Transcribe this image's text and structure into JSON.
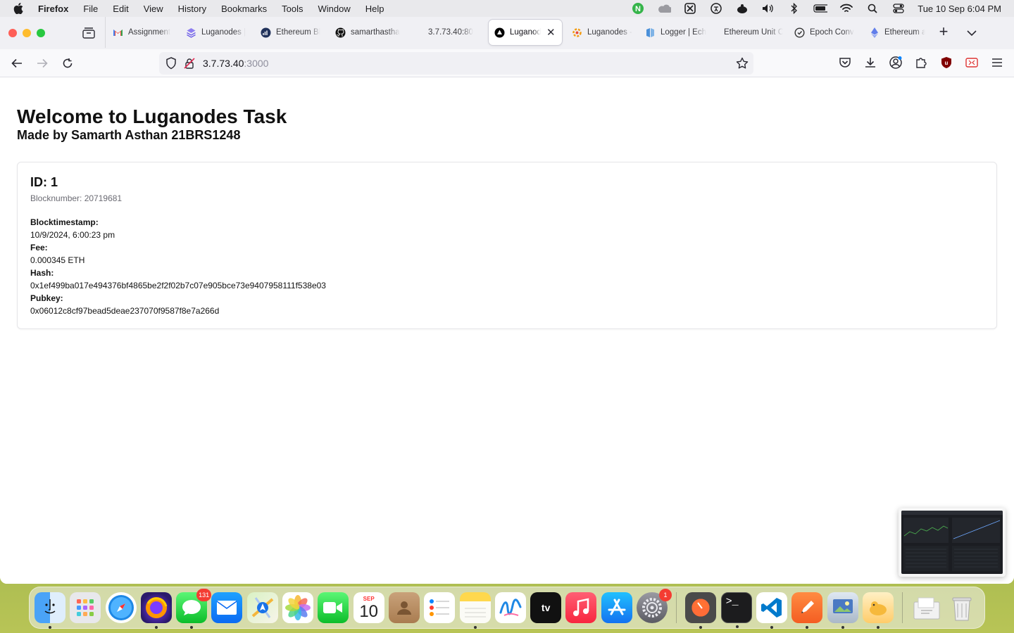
{
  "menubar": {
    "app_name": "Firefox",
    "items": [
      "File",
      "Edit",
      "View",
      "History",
      "Bookmarks",
      "Tools",
      "Window",
      "Help"
    ],
    "clock": "Tue 10 Sep  6:04 PM"
  },
  "tabs": [
    {
      "title": "Assignment",
      "icon": "gmail-icon",
      "color": "#ea4335"
    },
    {
      "title": "Luganodes |",
      "icon": "luganodes-icon",
      "color": "#6c5ce7"
    },
    {
      "title": "Ethereum Bl",
      "icon": "etherscan-icon",
      "color": "#21325b"
    },
    {
      "title": "samarthastha",
      "icon": "github-icon",
      "color": "#111111"
    },
    {
      "title": "3.7.73.40:80",
      "icon": "",
      "color": ""
    },
    {
      "title": "Luganodes",
      "icon": "triangle-icon",
      "color": "#000000",
      "active": true
    },
    {
      "title": "Luganodes -",
      "icon": "luganodes-icon",
      "color": "#f39c12"
    },
    {
      "title": "Logger | Ech",
      "icon": "logger-icon",
      "color": "#4a90d9"
    },
    {
      "title": "Ethereum Unit C",
      "icon": "",
      "color": ""
    },
    {
      "title": "Epoch Conv",
      "icon": "clock-icon",
      "color": "#333333"
    },
    {
      "title": "Ethereum ac",
      "icon": "ethereum-icon",
      "color": "#627eea"
    }
  ],
  "navbar": {
    "url_host": "3.7.73.40",
    "url_port": ":3000"
  },
  "page": {
    "title": "Welcome to Luganodes Task",
    "subtitle": "Made by Samarth Asthan 21BRS1248"
  },
  "record": {
    "id_text": "ID: 1",
    "blocknumber_text": "Blocknumber: 20719681",
    "blocktimestamp_label": "Blocktimestamp:",
    "blocktimestamp_value": "10/9/2024, 6:00:23 pm",
    "fee_label": "Fee:",
    "fee_value": "0.000345 ETH",
    "hash_label": "Hash:",
    "hash_value": "0x1ef499ba017e494376bf4865be2f2f02b7c07e905bce73e9407958111f538e03",
    "pubkey_label": "Pubkey:",
    "pubkey_value": "0x06012c8cf97bead5deae237070f9587f8e7a266d"
  },
  "dock": {
    "messages_badge": "131",
    "calendar_month": "SEP",
    "calendar_day": "10",
    "settings_badge": "1",
    "apps": [
      "finder-icon",
      "launchpad-icon",
      "safari-icon",
      "firefox-icon",
      "messages-icon",
      "mail-icon",
      "maps-icon",
      "photos-icon",
      "facetime-icon",
      "calendar-icon",
      "contacts-icon",
      "reminders-icon",
      "notes-icon",
      "freeform-icon",
      "appletv-icon",
      "music-icon",
      "appstore-icon",
      "settings-icon",
      "postman-icon",
      "terminal-icon",
      "vscode-icon",
      "pencil-app-icon",
      "preview-icon",
      "tableplus-icon",
      "downloads-stack-icon",
      "trash-icon"
    ]
  }
}
